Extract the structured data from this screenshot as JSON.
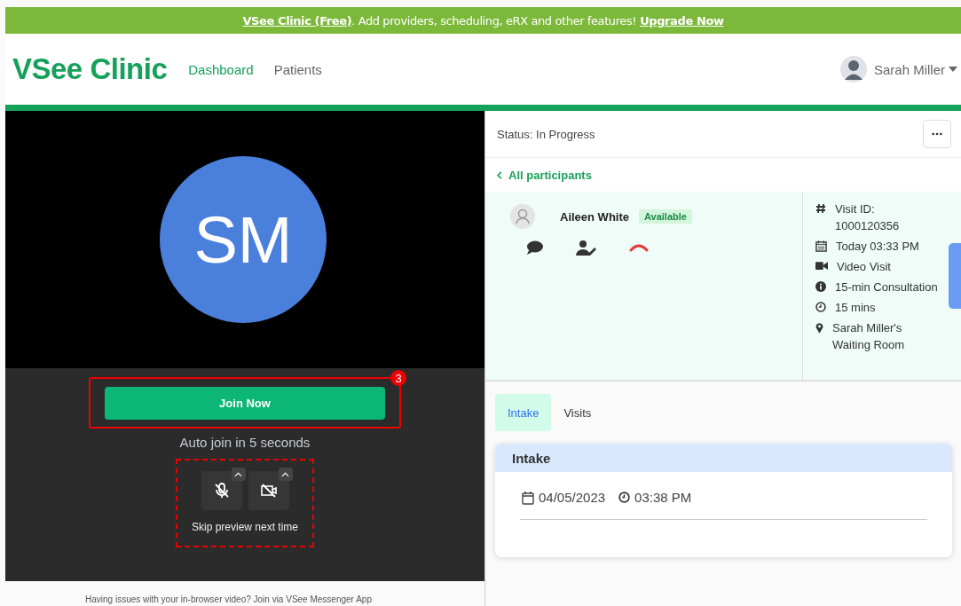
{
  "banner": {
    "text": "**VSee Clinic (Free)**. Add providers, scheduling, eRX and other features!",
    "link": "Upgrade Now"
  },
  "header": {
    "logo": "VSee Clinic",
    "nav": [
      {
        "label": "Dashboard",
        "selected": true
      },
      {
        "label": "Patients",
        "selected": false
      }
    ],
    "user": "Sarah Miller"
  },
  "preview": {
    "initials": "SM",
    "join_button": "Join Now",
    "auto_join": "Auto join in 5 seconds",
    "controls": [
      {
        "kind": "mic",
        "muted": true
      },
      {
        "kind": "camera",
        "muted": true
      }
    ],
    "skip": "Skip preview next time",
    "annotation_badge": "3",
    "help": "Having issues with your in-browser video? Join via VSee Messenger App"
  },
  "visit": {
    "status": "Status: In Progress",
    "back_link": "All participants",
    "participant": {
      "name": "Aileen White",
      "badge": "Available"
    },
    "details": [
      {
        "kind": "id",
        "text": "Visit ID: 1000120356"
      },
      {
        "kind": "date",
        "text": "Today 03:33 PM"
      },
      {
        "kind": "video",
        "text": "Video Visit"
      },
      {
        "kind": "info",
        "text": "15-min Consultation"
      },
      {
        "kind": "time",
        "text": "15 mins"
      },
      {
        "kind": "place",
        "text": "Sarah Miller's Waiting Room"
      }
    ]
  },
  "tabs": [
    {
      "label": "Intake",
      "selected": true
    },
    {
      "label": "Visits",
      "selected": false
    }
  ],
  "intake": {
    "title": "Intake",
    "date": "04/05/2023",
    "time": "03:38 PM"
  }
}
